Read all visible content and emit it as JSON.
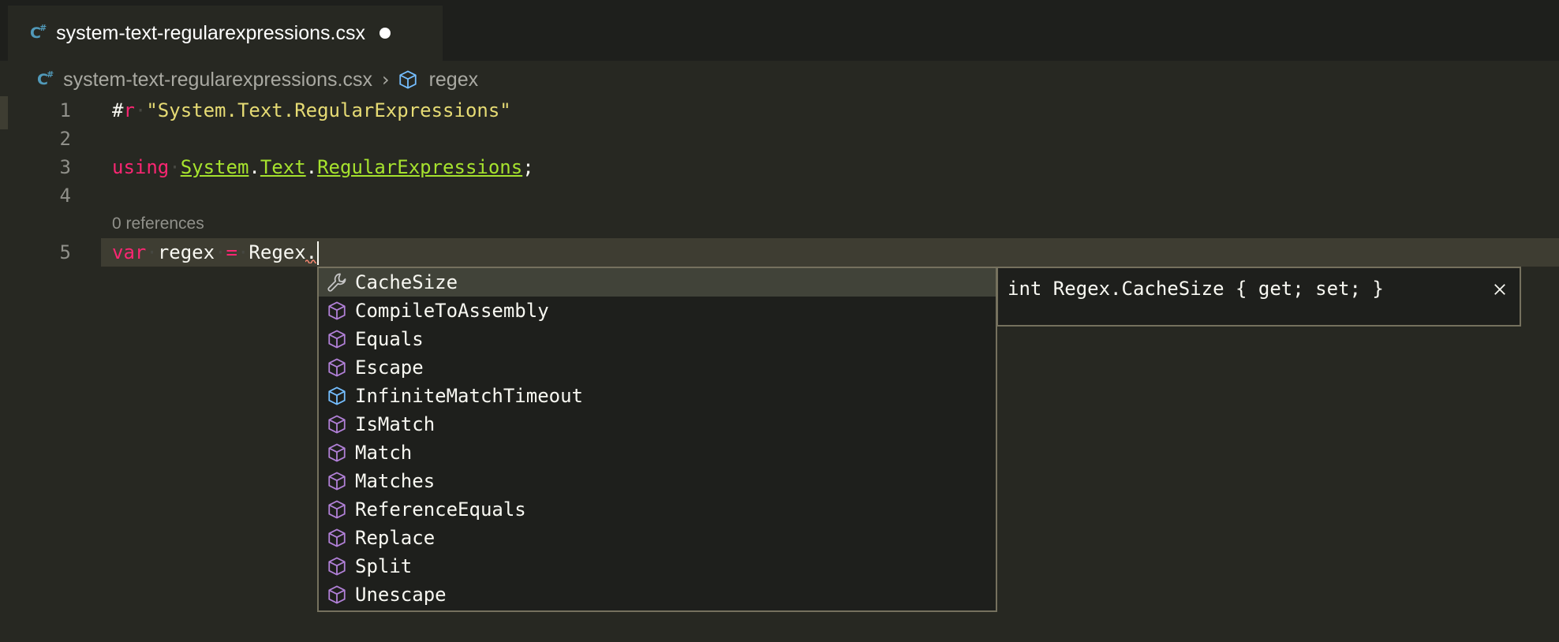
{
  "tab": {
    "file_icon": "C#",
    "title": "system-text-regularexpressions.csx",
    "dirty": true
  },
  "breadcrumb": {
    "file_icon": "C#",
    "file": "system-text-regularexpressions.csx",
    "separator": ">",
    "symbol_icon": "cube-icon",
    "symbol": "regex"
  },
  "editor": {
    "codelens": "0 references",
    "lines": [
      {
        "number": "1",
        "tokens": [
          {
            "text": "#",
            "kind": "plain"
          },
          {
            "text": "r",
            "kind": "keyword"
          },
          {
            "text": "·",
            "kind": "whitespace"
          },
          {
            "text": "\"System.Text.RegularExpressions\"",
            "kind": "string"
          }
        ]
      },
      {
        "number": "2",
        "tokens": []
      },
      {
        "number": "3",
        "tokens": [
          {
            "text": "using",
            "kind": "keyword"
          },
          {
            "text": "·",
            "kind": "whitespace"
          },
          {
            "text": "System",
            "kind": "namespace"
          },
          {
            "text": ".",
            "kind": "plain"
          },
          {
            "text": "Text",
            "kind": "namespace"
          },
          {
            "text": ".",
            "kind": "plain"
          },
          {
            "text": "RegularExpressions",
            "kind": "namespace"
          },
          {
            "text": ";",
            "kind": "plain"
          }
        ]
      },
      {
        "number": "4",
        "tokens": []
      },
      {
        "number": "5",
        "tokens": [
          {
            "text": "var",
            "kind": "keyword"
          },
          {
            "text": "·",
            "kind": "whitespace"
          },
          {
            "text": "regex",
            "kind": "plain"
          },
          {
            "text": "·",
            "kind": "whitespace"
          },
          {
            "text": "=",
            "kind": "keyword"
          },
          {
            "text": "·",
            "kind": "whitespace"
          },
          {
            "text": "Regex.",
            "kind": "plain"
          }
        ]
      }
    ]
  },
  "suggest": {
    "items": [
      {
        "label": "CacheSize",
        "icon": "wrench-icon",
        "selected": true
      },
      {
        "label": "CompileToAssembly",
        "icon": "method-cube-icon"
      },
      {
        "label": "Equals",
        "icon": "method-cube-icon"
      },
      {
        "label": "Escape",
        "icon": "method-cube-icon"
      },
      {
        "label": "InfiniteMatchTimeout",
        "icon": "field-cube-icon"
      },
      {
        "label": "IsMatch",
        "icon": "method-cube-icon"
      },
      {
        "label": "Match",
        "icon": "method-cube-icon"
      },
      {
        "label": "Matches",
        "icon": "method-cube-icon"
      },
      {
        "label": "ReferenceEquals",
        "icon": "method-cube-icon"
      },
      {
        "label": "Replace",
        "icon": "method-cube-icon"
      },
      {
        "label": "Split",
        "icon": "method-cube-icon"
      },
      {
        "label": "Unescape",
        "icon": "method-cube-icon"
      }
    ],
    "details": "int Regex.CacheSize { get; set; }",
    "close_icon": "close-icon"
  },
  "colors": {
    "background": "#272822",
    "keyword": "#f92672",
    "string": "#e6db74",
    "namespace": "#a6e22e",
    "method_icon": "#b180d7",
    "field_icon": "#75beff"
  }
}
